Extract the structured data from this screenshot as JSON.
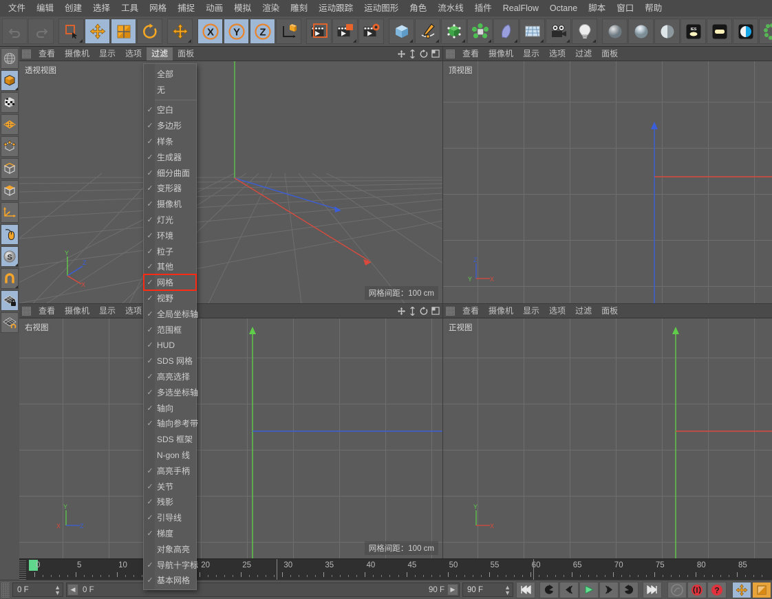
{
  "menubar": {
    "items": [
      "文件",
      "编辑",
      "创建",
      "选择",
      "工具",
      "网格",
      "捕捉",
      "动画",
      "模拟",
      "渲染",
      "雕刻",
      "运动跟踪",
      "运动图形",
      "角色",
      "流水线",
      "插件",
      "RealFlow",
      "Octane",
      "脚本",
      "窗口",
      "帮助"
    ]
  },
  "viewports": {
    "menu_items": [
      "查看",
      "摄像机",
      "显示",
      "选项",
      "过滤",
      "面板"
    ],
    "active_menu": "过滤",
    "perspective": {
      "label": "透视视图",
      "grid_info": "网格间距：100 cm"
    },
    "top": {
      "label": "顶视图",
      "grid_info": ""
    },
    "right": {
      "label": "右视图",
      "grid_info": "网格间距：100 cm"
    },
    "front": {
      "label": "正视图",
      "grid_info": ""
    }
  },
  "filter_menu": {
    "title": "过滤",
    "header_items": [
      {
        "label": "全部",
        "checked": false
      },
      {
        "label": "无",
        "checked": false
      }
    ],
    "items": [
      {
        "label": "空白",
        "checked": true,
        "highlighted": false
      },
      {
        "label": "多边形",
        "checked": true,
        "highlighted": false
      },
      {
        "label": "样条",
        "checked": true,
        "highlighted": false
      },
      {
        "label": "生成器",
        "checked": true,
        "highlighted": false
      },
      {
        "label": "细分曲面",
        "checked": true,
        "highlighted": false
      },
      {
        "label": "变形器",
        "checked": true,
        "highlighted": false
      },
      {
        "label": "摄像机",
        "checked": true,
        "highlighted": false
      },
      {
        "label": "灯光",
        "checked": true,
        "highlighted": false
      },
      {
        "label": "环境",
        "checked": true,
        "highlighted": false
      },
      {
        "label": "粒子",
        "checked": true,
        "highlighted": false
      },
      {
        "label": "其他",
        "checked": true,
        "highlighted": false
      },
      {
        "label": "网格",
        "checked": true,
        "highlighted": true
      },
      {
        "label": "视野",
        "checked": true,
        "highlighted": false
      },
      {
        "label": "全局坐标轴",
        "checked": true,
        "highlighted": false
      },
      {
        "label": "范围框",
        "checked": true,
        "highlighted": false
      },
      {
        "label": "HUD",
        "checked": true,
        "highlighted": false
      },
      {
        "label": "SDS 网格",
        "checked": true,
        "highlighted": false
      },
      {
        "label": "高亮选择",
        "checked": true,
        "highlighted": false
      },
      {
        "label": "多选坐标轴",
        "checked": true,
        "highlighted": false
      },
      {
        "label": "轴向",
        "checked": true,
        "highlighted": false
      },
      {
        "label": "轴向参考带",
        "checked": true,
        "highlighted": false
      },
      {
        "label": "SDS 框架",
        "checked": false,
        "highlighted": false
      },
      {
        "label": "N-gon 线",
        "checked": false,
        "highlighted": false
      },
      {
        "label": "高亮手柄",
        "checked": true,
        "highlighted": false
      },
      {
        "label": "关节",
        "checked": true,
        "highlighted": false
      },
      {
        "label": "残影",
        "checked": true,
        "highlighted": false
      },
      {
        "label": "引导线",
        "checked": true,
        "highlighted": false
      },
      {
        "label": "梯度",
        "checked": true,
        "highlighted": false
      },
      {
        "label": "对象高亮",
        "checked": false,
        "highlighted": false
      },
      {
        "label": "导航十字标",
        "checked": true,
        "highlighted": false
      },
      {
        "label": "基本网格",
        "checked": true,
        "highlighted": false
      }
    ]
  },
  "timeline": {
    "ticks": [
      "0",
      "5",
      "10",
      "15",
      "20",
      "25",
      "30",
      "35",
      "40",
      "45",
      "50",
      "55",
      "60",
      "65",
      "70",
      "75",
      "80",
      "85"
    ],
    "current_frame_marker": "0"
  },
  "bottombar": {
    "current_frame": "0 F",
    "range_start": "0 F",
    "range_end": "90 F",
    "end_frame": "90 F"
  },
  "colors": {
    "accent_orange": "#f09a1e",
    "selection_blue": "#9fb8d6",
    "axis_x": "#d94a3d",
    "axis_y": "#5fcc4a",
    "axis_z": "#3a5fd9",
    "highlight_red": "#ff2b15",
    "play_green": "#5fd68c",
    "panel_bg": "#555555",
    "viewport_bg": "#5b5b5b"
  },
  "toolbar": {
    "groups": [
      {
        "buttons": [
          {
            "name": "undo-button",
            "icon": "undo",
            "state": "disabled"
          },
          {
            "name": "redo-button",
            "icon": "redo",
            "state": "disabled"
          }
        ]
      },
      {
        "buttons": [
          {
            "name": "live-selection-button",
            "icon": "select-rect",
            "state": "normal"
          },
          {
            "name": "move-tool-button",
            "icon": "move",
            "state": "selected"
          },
          {
            "name": "scale-tool-button",
            "icon": "scale",
            "state": "normal"
          },
          {
            "name": "rotate-tool-button",
            "icon": "rotate",
            "state": "normal"
          }
        ]
      },
      {
        "buttons": [
          {
            "name": "move-axis-button",
            "icon": "move-alt",
            "state": "normal"
          }
        ]
      },
      {
        "buttons": [
          {
            "name": "axis-x-button",
            "icon": "x-axis",
            "state": "selected"
          },
          {
            "name": "axis-y-button",
            "icon": "y-axis",
            "state": "selected"
          },
          {
            "name": "axis-z-button",
            "icon": "z-axis",
            "state": "selected"
          },
          {
            "name": "world-coord-button",
            "icon": "world-axis",
            "state": "normal"
          }
        ]
      },
      {
        "buttons": [
          {
            "name": "render-view-button",
            "icon": "render-view",
            "state": "normal"
          },
          {
            "name": "render-region-button",
            "icon": "render-region",
            "state": "normal"
          },
          {
            "name": "render-settings-button",
            "icon": "render-settings",
            "state": "normal"
          }
        ]
      },
      {
        "buttons": [
          {
            "name": "cube-primitive-button",
            "icon": "cube",
            "state": "normal"
          },
          {
            "name": "spline-pen-button",
            "icon": "pen",
            "state": "normal"
          },
          {
            "name": "nurbs-button",
            "icon": "nurbs",
            "state": "normal"
          },
          {
            "name": "array-button",
            "icon": "array",
            "state": "normal"
          },
          {
            "name": "deformer-button",
            "icon": "bend",
            "state": "normal"
          },
          {
            "name": "scene-button",
            "icon": "floor",
            "state": "normal"
          },
          {
            "name": "camera-button",
            "icon": "camera",
            "state": "normal"
          },
          {
            "name": "light-button",
            "icon": "light",
            "state": "normal"
          }
        ]
      },
      {
        "buttons": [
          {
            "name": "octane-diffuse-button",
            "icon": "sphere-grey",
            "state": "normal"
          },
          {
            "name": "octane-glossy-button",
            "icon": "sphere-glossy",
            "state": "normal"
          },
          {
            "name": "octane-specular-button",
            "icon": "sphere-specular",
            "state": "normal"
          },
          {
            "name": "octane-ies-button",
            "icon": "ies",
            "state": "normal"
          },
          {
            "name": "octane-light-button",
            "icon": "area-light",
            "state": "normal"
          },
          {
            "name": "octane-hdri-button",
            "icon": "hdri",
            "state": "normal"
          },
          {
            "name": "octane-scatter-button",
            "icon": "scatter",
            "state": "normal"
          }
        ]
      }
    ]
  },
  "leftbar": {
    "buttons": [
      {
        "name": "sidebar-globe-button",
        "icon": "globe",
        "state": "normal"
      },
      {
        "name": "sidebar-model-button",
        "icon": "model-cube",
        "state": "selected"
      },
      {
        "name": "sidebar-texture-button",
        "icon": "texture-cube",
        "state": "normal"
      },
      {
        "name": "sidebar-points-button",
        "icon": "points-grid",
        "state": "normal"
      },
      {
        "name": "sidebar-vertex-button",
        "icon": "vertex-cube",
        "state": "normal"
      },
      {
        "name": "sidebar-edge-button",
        "icon": "edge-cube",
        "state": "normal"
      },
      {
        "name": "sidebar-polygon-button",
        "icon": "polygon-cube",
        "state": "normal"
      },
      {
        "name": "sidebar-axis-button",
        "icon": "axis",
        "state": "normal"
      },
      {
        "name": "sidebar-mouse-button",
        "icon": "mouse",
        "state": "selected"
      },
      {
        "name": "sidebar-snap-button",
        "icon": "s-circle",
        "state": "selected"
      },
      {
        "name": "sidebar-magnet-button",
        "icon": "magnet",
        "state": "normal"
      },
      {
        "name": "sidebar-lock-grid-button",
        "icon": "grid-lock",
        "state": "selected"
      },
      {
        "name": "sidebar-workplane-button",
        "icon": "grid-orange",
        "state": "normal"
      }
    ]
  },
  "playback": {
    "buttons": [
      {
        "name": "go-to-start-button",
        "icon": "skip-start"
      },
      {
        "name": "play-backward-loop-button",
        "icon": "loop-back"
      },
      {
        "name": "step-back-button",
        "icon": "prev-frame"
      },
      {
        "name": "play-button",
        "icon": "play"
      },
      {
        "name": "step-forward-button",
        "icon": "next-frame"
      },
      {
        "name": "play-forward-loop-button",
        "icon": "loop-fwd"
      },
      {
        "name": "go-to-end-button",
        "icon": "skip-end"
      },
      {
        "name": "record-disabled-button",
        "icon": "key-disabled"
      },
      {
        "name": "autokey-button",
        "icon": "autokey-red"
      },
      {
        "name": "keyframe-help-button",
        "icon": "question-red"
      }
    ]
  }
}
